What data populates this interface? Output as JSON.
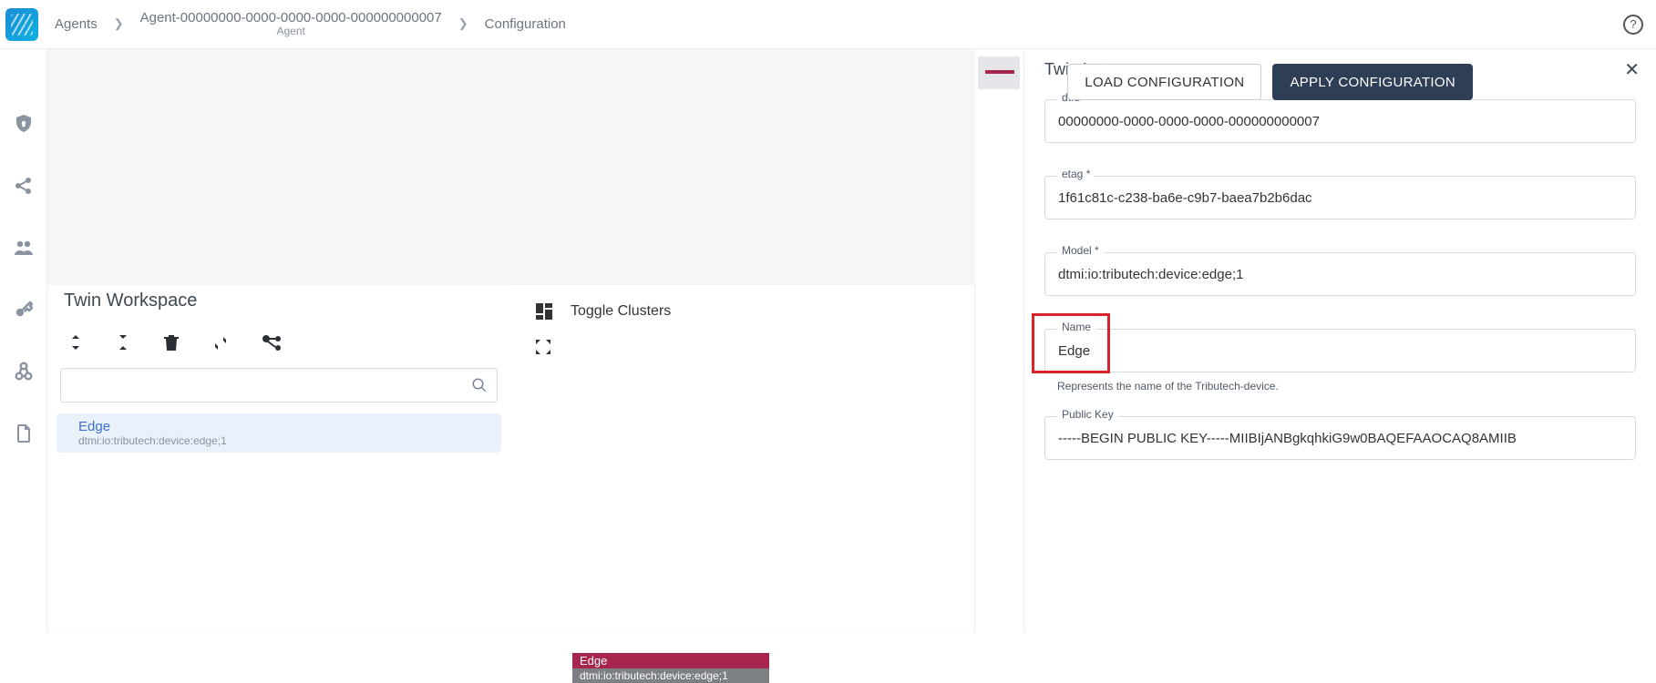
{
  "breadcrumb": {
    "root": "Agents",
    "agent_name": "Agent-00000000-0000-0000-0000-000000000007",
    "agent_sub": "Agent",
    "page": "Configuration"
  },
  "actions": {
    "load": "LOAD CONFIGURATION",
    "apply": "APPLY CONFIGURATION"
  },
  "workspace": {
    "title": "Twin Workspace",
    "item": {
      "title": "Edge",
      "subtitle": "dtmi:io:tributech:device:edge;1"
    }
  },
  "canvas": {
    "toggle": "Toggle Clusters",
    "node_title": "Edge",
    "node_sub": "dtmi:io:tributech:device:edge;1"
  },
  "instance": {
    "title": "Twin Instance",
    "dtid_label": "dtId *",
    "dtid": "00000000-0000-0000-0000-000000000007",
    "etag_label": "etag *",
    "etag": "1f61c81c-c238-ba6e-c9b7-baea7b2b6dac",
    "model_label": "Model *",
    "model": "dtmi:io:tributech:device:edge;1",
    "name_label": "Name",
    "name": "Edge",
    "name_hint": "Represents the name of the Tributech-device.",
    "pk_label": "Public Key",
    "pk": "-----BEGIN PUBLIC KEY-----MIIBIjANBgkqhkiG9w0BAQEFAAOCAQ8AMIIB"
  }
}
